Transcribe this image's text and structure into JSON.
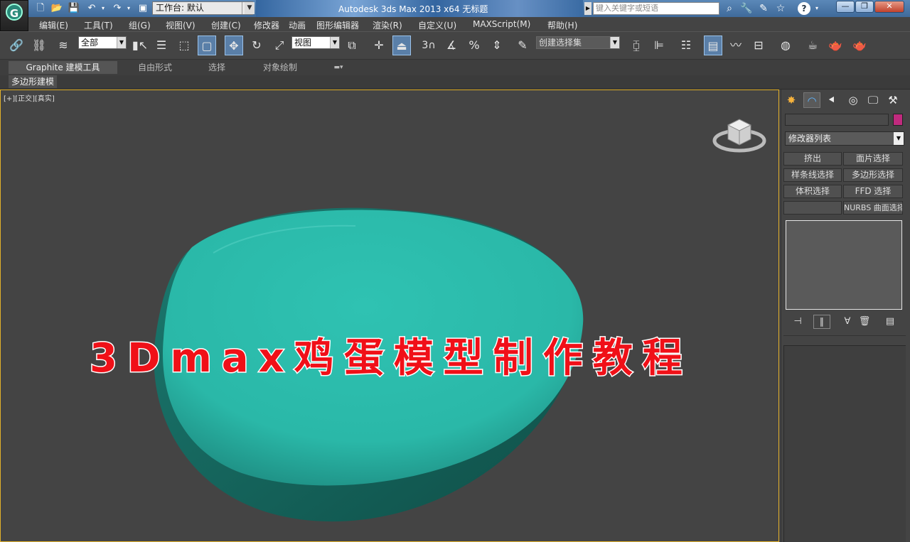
{
  "titlebar": {
    "workspace_prefix": "工作台: 默认",
    "title": "Autodesk 3ds Max  2013 x64      无标题",
    "search_placeholder": "键入关键字或短语",
    "minimize": "—",
    "restore": "❐",
    "close": "✕"
  },
  "menu": [
    "编辑(E)",
    "工具(T)",
    "组(G)",
    "视图(V)",
    "创建(C)",
    "修改器",
    "动画",
    "图形编辑器",
    "渲染(R)",
    "自定义(U)",
    "MAXScript(M)",
    "帮助(H)"
  ],
  "toolbar": {
    "selection_filter": "全部",
    "ref_coord": "视图",
    "snap_label": "3",
    "named_selection": "创建选择集"
  },
  "ribbon": {
    "tabs": [
      "Graphite 建模工具",
      "自由形式",
      "选择",
      "对象绘制"
    ],
    "subtab": "多边形建模"
  },
  "viewport": {
    "label": "[+][正交][真实]",
    "overlay_title": "3Dmax鸡蛋模型制作教程",
    "object_color": "#2ab8a8"
  },
  "command_panel": {
    "modifier_list": "修改器列表",
    "buttons": [
      "挤出",
      "面片选择",
      "样条线选择",
      "多边形选择",
      "体积选择",
      "FFD 选择",
      "",
      "NURBS 曲面选择"
    ],
    "object_color": "#c02a7e"
  }
}
